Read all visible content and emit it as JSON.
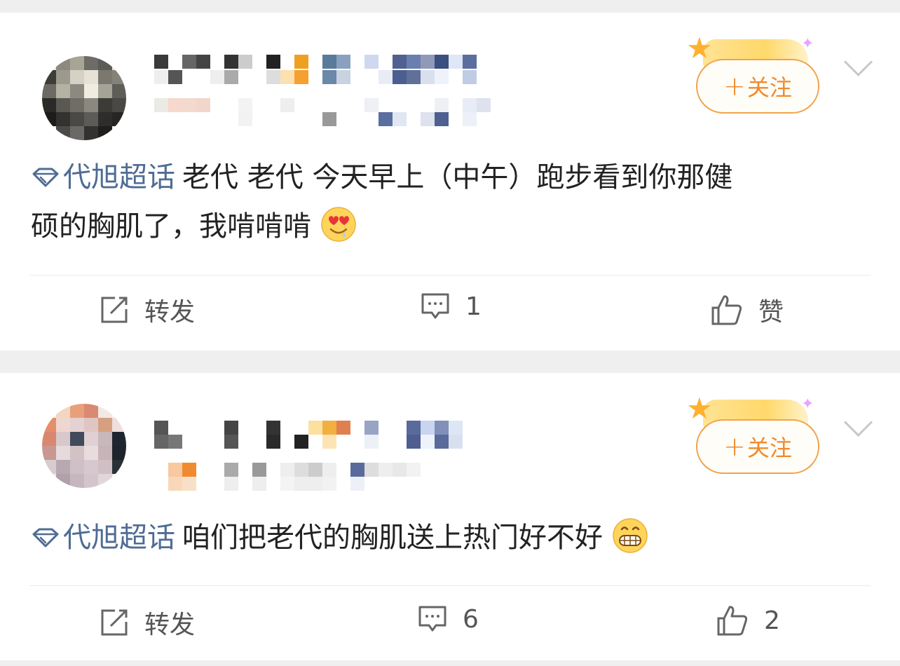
{
  "posts": [
    {
      "follow_label": "关注",
      "follow_plus": "+",
      "topic": "代旭超话",
      "text_line1": "老代 老代 今天早上（中午）跑步看到你那健",
      "text_line2": "硕的胸肌了，我啃啃啃",
      "emoji": "heart-eyes-drool",
      "actions": {
        "repost": "转发",
        "comment_count": "1",
        "like": "赞"
      }
    },
    {
      "follow_label": "关注",
      "follow_plus": "+",
      "topic": "代旭超话",
      "text_line1": "咱们把老代的胸肌送上热门好不好",
      "emoji": "grin",
      "actions": {
        "repost": "转发",
        "comment_count": "6",
        "like": "2"
      }
    }
  ],
  "colors": {
    "topic": "#4f6c94",
    "follow": "#f08a2c",
    "background": "#efefef"
  }
}
